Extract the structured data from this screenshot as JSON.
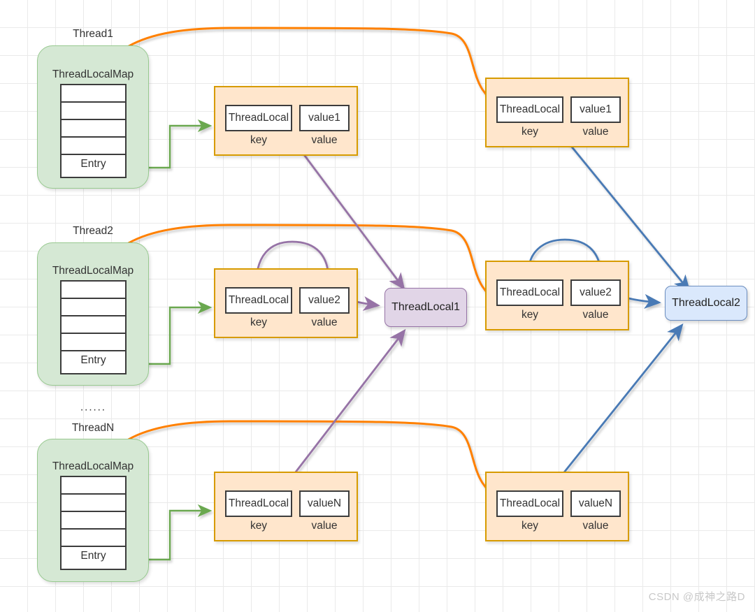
{
  "diagram": {
    "title": "ThreadLocal / ThreadLocalMap relationship diagram",
    "colors": {
      "thread_fill": "#d5e8d4",
      "thread_stroke": "#97c98f",
      "entry_fill": "#ffe6cc",
      "entry_stroke": "#d79b00",
      "purple_fill": "#e1d5e7",
      "purple_stroke": "#9673a6",
      "blue_fill": "#dae8fc",
      "blue_stroke": "#6c8ebf",
      "green_arrow": "#6aa84f",
      "orange_arrow": "#ff8000",
      "purple_arrow": "#9673a6",
      "blue_arrow": "#4a7ab5",
      "grid_line": "#eaeaea",
      "text": "#333333"
    }
  },
  "threads": [
    {
      "name": "Thread1",
      "dots_above": "",
      "map_title": "ThreadLocalMap",
      "rows": [
        "",
        "",
        "",
        "",
        "Entry"
      ],
      "entry_label": "Entry"
    },
    {
      "name": "Thread2",
      "dots_above": "",
      "map_title": "ThreadLocalMap",
      "rows": [
        "",
        "",
        "",
        "",
        "Entry"
      ],
      "entry_label": "Entry"
    },
    {
      "name": "ThreadN",
      "dots_above": "······",
      "map_title": "ThreadLocalMap",
      "rows": [
        "",
        "",
        "",
        "",
        "Entry"
      ],
      "entry_label": "Entry"
    }
  ],
  "entry_boxes": [
    {
      "id": "l1",
      "column": "left",
      "row": 1,
      "key": "ThreadLocal",
      "value": "value1",
      "key_caption": "key",
      "value_caption": "value"
    },
    {
      "id": "r1",
      "column": "right",
      "row": 1,
      "key": "ThreadLocal",
      "value": "value1",
      "key_caption": "key",
      "value_caption": "value"
    },
    {
      "id": "l2",
      "column": "left",
      "row": 2,
      "key": "ThreadLocal",
      "value": "value2",
      "key_caption": "key",
      "value_caption": "value"
    },
    {
      "id": "r2",
      "column": "right",
      "row": 2,
      "key": "ThreadLocal",
      "value": "value2",
      "key_caption": "key",
      "value_caption": "value"
    },
    {
      "id": "l3",
      "column": "left",
      "row": 3,
      "key": "ThreadLocal",
      "value": "valueN",
      "key_caption": "key",
      "value_caption": "value"
    },
    {
      "id": "r3",
      "column": "right",
      "row": 3,
      "key": "ThreadLocal",
      "value": "valueN",
      "key_caption": "key",
      "value_caption": "value"
    }
  ],
  "shared_nodes": [
    {
      "id": "tl1",
      "label": "ThreadLocal1",
      "style": "purple"
    },
    {
      "id": "tl2",
      "label": "ThreadLocal2",
      "style": "blue"
    }
  ],
  "watermark": "CSDN @成神之路D"
}
